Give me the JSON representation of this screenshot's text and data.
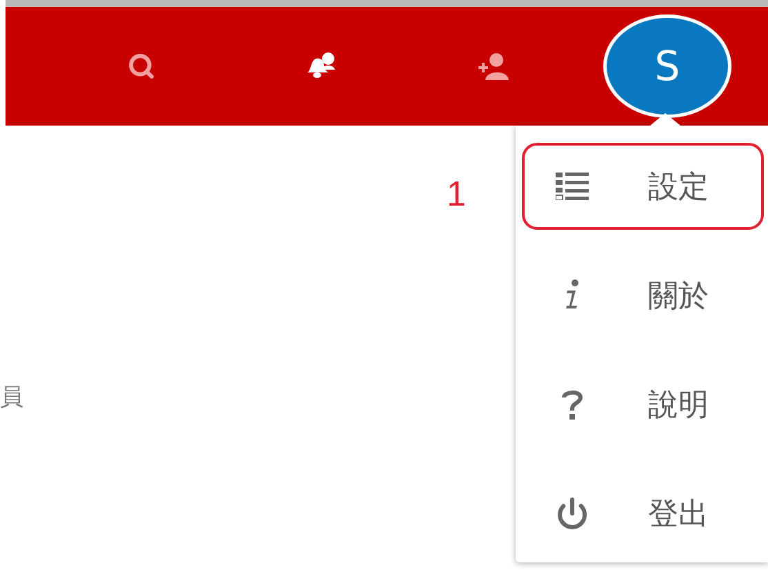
{
  "header": {
    "avatar": {
      "initial": "S"
    }
  },
  "side_text": "員",
  "annotation": "1",
  "menu": {
    "items": [
      {
        "kind": "settings",
        "label": "設定",
        "highlighted": true
      },
      {
        "kind": "about",
        "label": "關於",
        "highlighted": false
      },
      {
        "kind": "help",
        "label": "說明",
        "highlighted": false
      },
      {
        "kind": "logout",
        "label": "登出",
        "highlighted": false
      }
    ]
  }
}
